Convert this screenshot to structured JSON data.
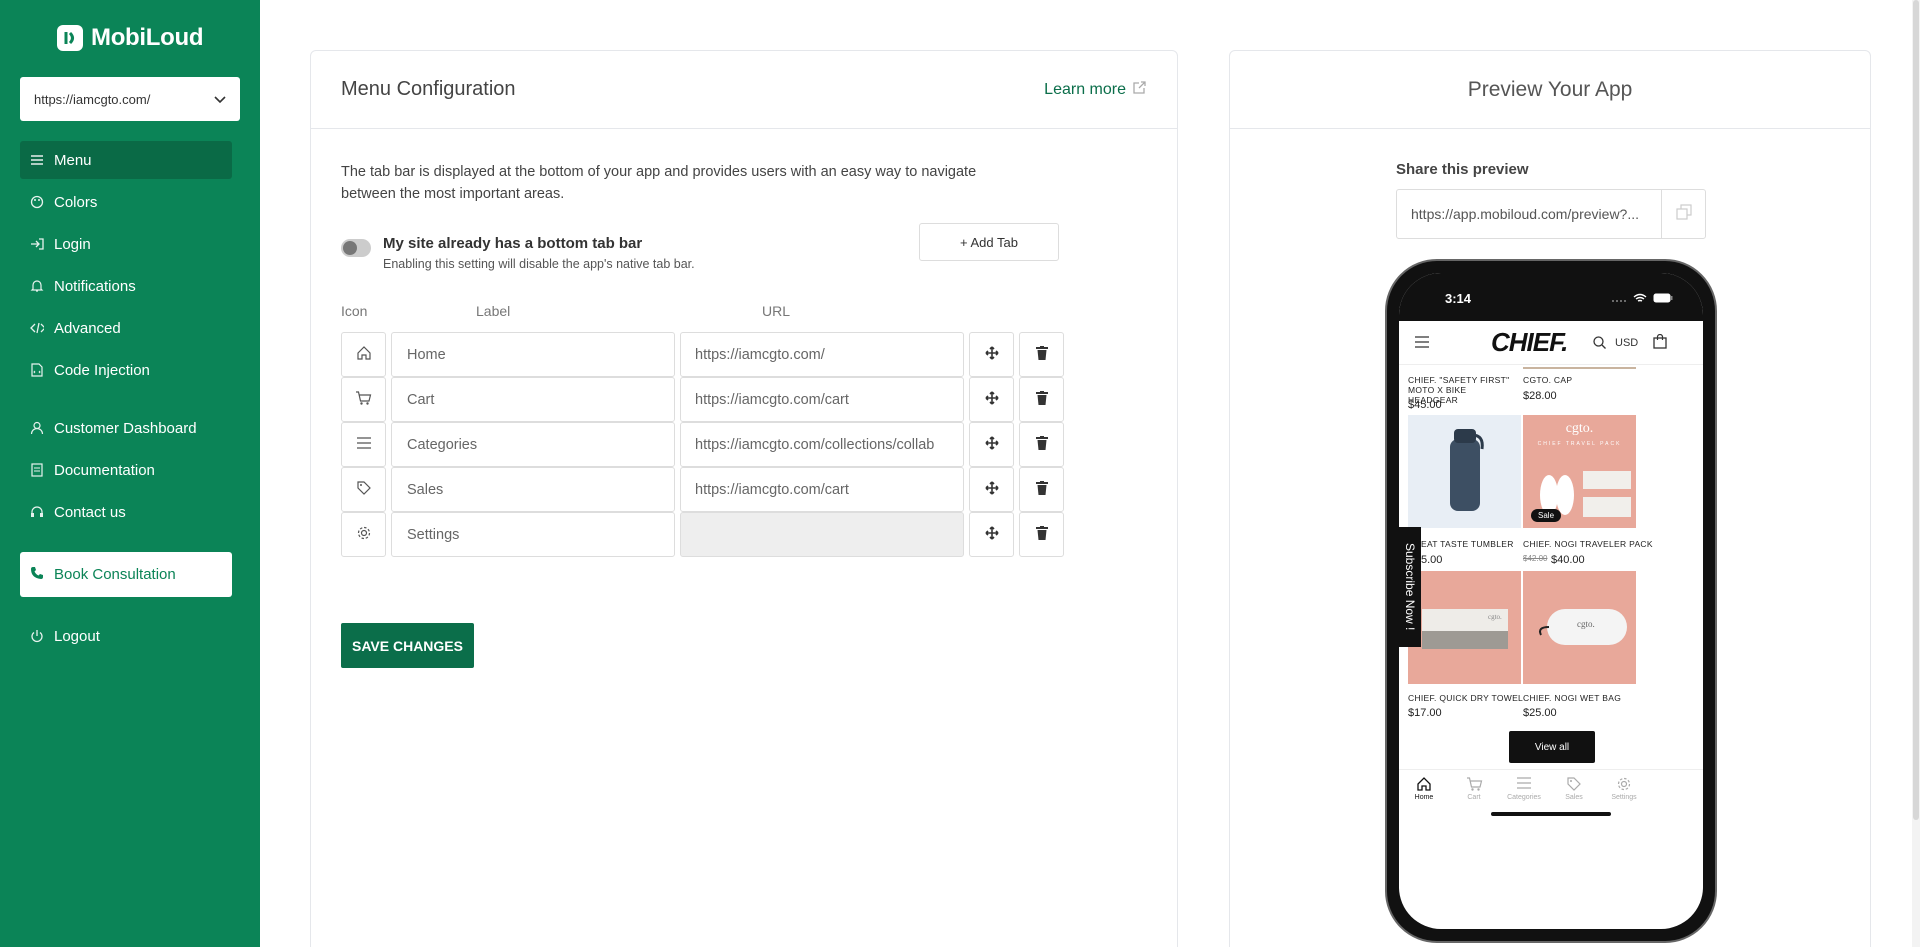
{
  "sidebar": {
    "logo": "MobiLoud",
    "site_select": "https://iamcgto.com/",
    "items": [
      {
        "label": "Menu",
        "icon": "menu-icon"
      },
      {
        "label": "Colors",
        "icon": "palette-icon"
      },
      {
        "label": "Login",
        "icon": "login-icon"
      },
      {
        "label": "Notifications",
        "icon": "bell-icon"
      },
      {
        "label": "Advanced",
        "icon": "code-icon"
      },
      {
        "label": "Code Injection",
        "icon": "file-code-icon"
      },
      {
        "label": "Customer Dashboard",
        "icon": "user-icon"
      },
      {
        "label": "Documentation",
        "icon": "document-icon"
      },
      {
        "label": "Contact us",
        "icon": "headset-icon"
      }
    ],
    "book": "Book Consultation",
    "logout": "Logout"
  },
  "menu_config": {
    "title": "Menu Configuration",
    "learn_more": "Learn more",
    "description": "The tab bar is displayed at the bottom of your app and provides users with an easy way to navigate between the most important areas.",
    "toggle_label": "My site already has a bottom tab bar",
    "toggle_sub": "Enabling this setting will disable the app's native tab bar.",
    "add_tab": "+ Add Tab",
    "columns": {
      "icon": "Icon",
      "label": "Label",
      "url": "URL"
    },
    "rows": [
      {
        "icon": "home-icon",
        "label": "Home",
        "url": "https://iamcgto.com/"
      },
      {
        "icon": "cart-icon",
        "label": "Cart",
        "url": "https://iamcgto.com/cart"
      },
      {
        "icon": "list-icon",
        "label": "Categories",
        "url": "https://iamcgto.com/collections/collab"
      },
      {
        "icon": "tag-icon",
        "label": "Sales",
        "url": "https://iamcgto.com/cart"
      },
      {
        "icon": "gear-icon",
        "label": "Settings",
        "url": ""
      }
    ],
    "save": "SAVE CHANGES"
  },
  "preview": {
    "title": "Preview Your App",
    "share_label": "Share this preview",
    "share_url": "https://app.mobiloud.com/preview?...",
    "phone": {
      "time": "3:14",
      "brand": "CHIEF.",
      "currency": "USD",
      "products": [
        {
          "name": "CHIEF. \"SAFETY FIRST\" MOTO X BIKE HEADGEAR",
          "price": "$45.00"
        },
        {
          "name": "CGTO. CAP",
          "price": "$28.00"
        },
        {
          "name": "EAT TASTE TUMBLER",
          "price": "5.00"
        },
        {
          "name": "CHIEF. NOGI TRAVELER PACK",
          "old_price": "$42.00",
          "price": "$40.00",
          "badge": "Sale",
          "img_text": "cgto.",
          "img_sub": "CHIEF TRAVEL PACK"
        },
        {
          "name": "CHIEF. QUICK DRY TOWEL",
          "price": "$17.00",
          "img_text": "cgto."
        },
        {
          "name": "CHIEF. NOGI WET BAG",
          "price": "$25.00",
          "img_text": "cgto."
        }
      ],
      "subscribe": "Subscribe Now !",
      "view_all": "View all",
      "tabs": [
        "Home",
        "Cart",
        "Categories",
        "Sales",
        "Settings"
      ]
    }
  },
  "colors": {
    "brand": "#0b8457",
    "brand_dark": "#0a6a46"
  }
}
